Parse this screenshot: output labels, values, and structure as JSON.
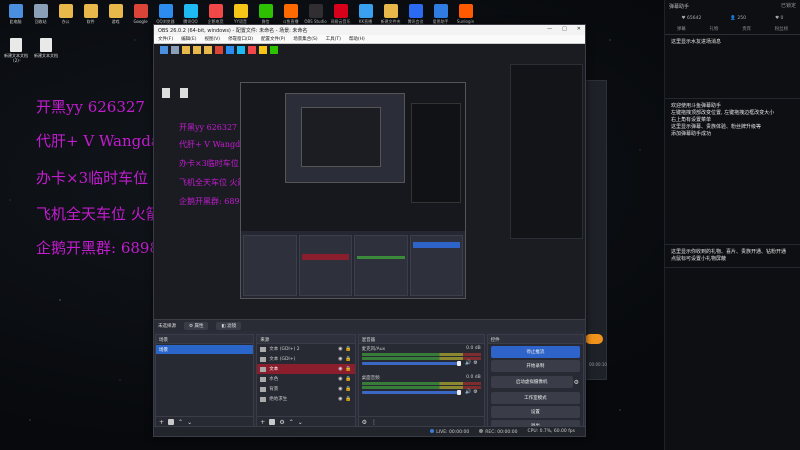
{
  "desktop": {
    "icons": [
      {
        "label": "此电脑",
        "color": "#4a8fe0"
      },
      {
        "label": "回收站",
        "color": "#8aa0b8"
      },
      {
        "label": "办公",
        "color": "#e8b84a"
      },
      {
        "label": "软件",
        "color": "#e8b84a"
      },
      {
        "label": "游戏",
        "color": "#e8b84a"
      },
      {
        "label": "Google",
        "color": "#db4437"
      },
      {
        "label": "QQ浏览器",
        "color": "#2d8cf0"
      },
      {
        "label": "腾讯QQ",
        "color": "#1ebaf3"
      },
      {
        "label": "企鹅电竞",
        "color": "#f04848"
      },
      {
        "label": "YY语音",
        "color": "#f5c518"
      },
      {
        "label": "微信",
        "color": "#2dc100"
      },
      {
        "label": "斗鱼直播",
        "color": "#ff6a00"
      },
      {
        "label": "OBS Studio",
        "color": "#302e31"
      },
      {
        "label": "网易云音乐",
        "color": "#d8001a"
      },
      {
        "label": "KK直播",
        "color": "#3aa0f0"
      },
      {
        "label": "新建文件夹",
        "color": "#e8b84a"
      },
      {
        "label": "腾讯会议",
        "color": "#2a6bf2"
      },
      {
        "label": "爱思助手",
        "color": "#2f7de1"
      },
      {
        "label": "Sunlogin",
        "color": "#ff5a00"
      }
    ],
    "files": [
      {
        "label": "新建文本文档 (2)"
      },
      {
        "label": "新建文本文档"
      }
    ]
  },
  "overlay": {
    "line1": "开黑yy    626327",
    "line2": "代肝+ V Wangdao-7788",
    "line3": "办卡×3临时车位",
    "line4": "飞机全天车位 火箭房管",
    "line5": "企鹅开黑群: 689840247"
  },
  "right_panel": {
    "title": "弹幕助手",
    "close": "已锁定",
    "stats": [
      "♥ 65642",
      "👤 250",
      "♥ 0"
    ],
    "tabs": [
      "弹幕",
      "礼物",
      "贵宾",
      "粉丝榜"
    ],
    "section1": "这里显示水友进场消息",
    "section2": "欢迎使用斗鱼弹幕助手\n左键拖拽顶部改变位置, 左键拖拽边框改变大小\n右上角有设置菜单\n这里显示弹幕、贵族体验、粉丝牌升级等\n添加弹幕助手成功",
    "section3": "这里显示你收到的礼物、喜片、贵族开通、钻粉开通\n点鼠标可设置小礼物屏蔽"
  },
  "obs": {
    "title": "OBS 26.0.2 (64-bit, windows) - 配置文件: 未命名 - 场景: 未命名",
    "window_buttons": [
      "—",
      "□",
      "✕"
    ],
    "menu": [
      "文件(F)",
      "编辑(E)",
      "视图(V)",
      "停靠窗口(D)",
      "配置文件(P)",
      "场景集合(S)",
      "工具(T)",
      "帮助(H)"
    ],
    "source_bar": {
      "no_source": "未选择源",
      "properties": "属性",
      "filters": "滤镜"
    },
    "scenes": {
      "header": "场景",
      "items": [
        "场景"
      ]
    },
    "sources": {
      "header": "来源",
      "items": [
        {
          "label": "文本 (GDI+) 2",
          "selected": false
        },
        {
          "label": "文本 (GDI+)",
          "selected": false
        },
        {
          "label": "文本",
          "selected": true
        },
        {
          "label": "水色",
          "selected": false
        },
        {
          "label": "背景",
          "selected": false
        },
        {
          "label": "绝地求生",
          "selected": false
        }
      ]
    },
    "mixer": {
      "header": "混音器",
      "channels": [
        {
          "name": "麦克风/Aux",
          "db": "0.0 dB"
        },
        {
          "name": "桌面音频",
          "db": "0.0 dB"
        }
      ]
    },
    "controls": {
      "header": "控件",
      "buttons": [
        "停止推流",
        "开始录制",
        "启动虚拟摄像机",
        "工作室模式",
        "设置",
        "退出"
      ]
    },
    "status": {
      "live": "LIVE: 00:00:00",
      "rec": "REC: 00:00:00",
      "cpu": "CPU: 0.7%, 60.00 fps"
    }
  },
  "inner": {
    "ov1": "开黑yy    626327",
    "ov2": "代肝+ V Wangdao-7788",
    "ov3": "办卡×3临时车位",
    "ov4": "飞机全天车位 火箭房管",
    "ov5": "企鹅开黑群: 689840247"
  },
  "bg_time": "00:00:10"
}
